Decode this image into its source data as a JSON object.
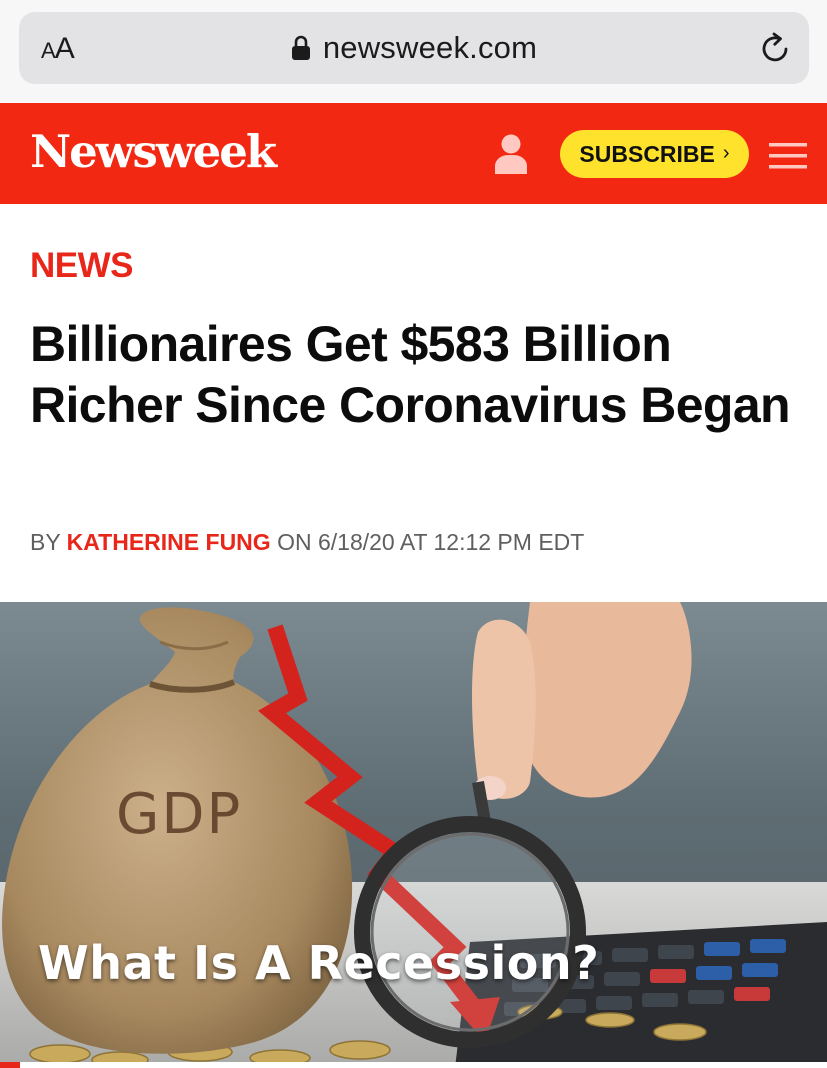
{
  "browser": {
    "text_size_small": "A",
    "text_size_large": "A",
    "url": "newsweek.com"
  },
  "header": {
    "logo": "Newsweek",
    "subscribe_label": "SUBSCRIBE",
    "subscribe_chevron": "›",
    "brand_red": "#f32813",
    "subscribe_yellow": "#ffe22b",
    "icons": [
      "user-icon",
      "menu-icon"
    ]
  },
  "article": {
    "section": "NEWS",
    "headline": "Billionaires Get $583 Billion Richer Since Coronavirus Began",
    "byline_prefix": "BY",
    "author": "KATHERINE FUNG",
    "byline_suffix": "ON 6/18/20 AT 12:12 PM EDT"
  },
  "hero": {
    "bag_text": "GDP",
    "caption": "What Is A Recession?"
  }
}
